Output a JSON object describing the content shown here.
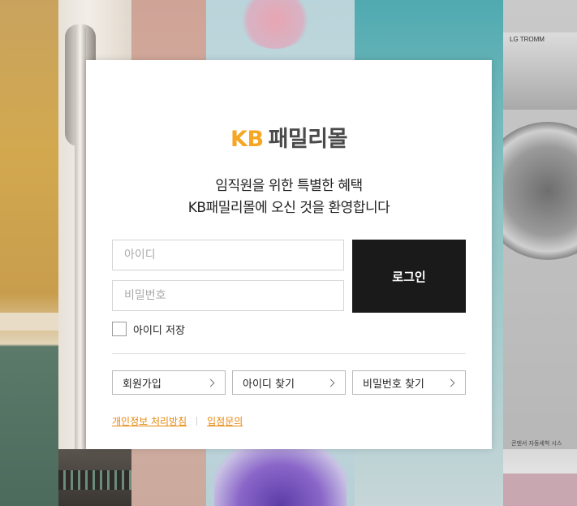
{
  "background": {
    "washer_brand": "LG   TROMM",
    "washer_caption": "콘덴서 자동세척 시스"
  },
  "login": {
    "logo_kb": "KB",
    "logo_mall": "패밀리몰",
    "welcome_line1": "임직원을 위한 특별한 혜택",
    "welcome_line2": "KB패밀리몰에 오신 것을 환영합니다",
    "id_placeholder": "아이디",
    "pw_placeholder": "비밀번호",
    "login_button": "로그인",
    "save_id_label": "아이디 저장",
    "signup": "회원가입",
    "find_id": "아이디 찾기",
    "find_pw": "비밀번호 찾기",
    "privacy_policy": "개인정보 처리방침",
    "partner_inquiry": "입점문의"
  },
  "colors": {
    "accent": "#f5a623",
    "link": "#e8860b",
    "button_bg": "#1a1a1a"
  }
}
